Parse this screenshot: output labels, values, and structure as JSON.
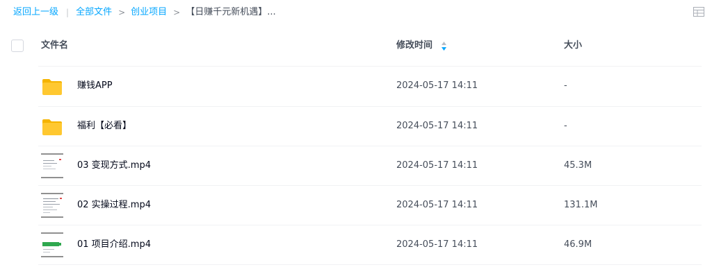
{
  "breadcrumb": {
    "back": "返回上一级",
    "separator": "|",
    "items": [
      {
        "label": "全部文件"
      },
      {
        "label": "创业项目"
      }
    ],
    "arrow": ">",
    "current": "【日赚千元新机遇】..."
  },
  "toolbar": {
    "view_icon": "grid-view-icon"
  },
  "table": {
    "headers": {
      "name": "文件名",
      "modified": "修改时间",
      "size": "大小"
    },
    "sort_icon": "sort-arrows-icon",
    "rows": [
      {
        "name": "赚钱APP",
        "modified": "2024-05-17 14:11",
        "size": "-",
        "kind": "folder"
      },
      {
        "name": "福利【必看】",
        "modified": "2024-05-17 14:11",
        "size": "-",
        "kind": "folder"
      },
      {
        "name": "03 变现方式.mp4",
        "modified": "2024-05-17 14:11",
        "size": "45.3M",
        "kind": "video"
      },
      {
        "name": "02 实操过程.mp4",
        "modified": "2024-05-17 14:11",
        "size": "131.1M",
        "kind": "video"
      },
      {
        "name": "01 项目介绍.mp4",
        "modified": "2024-05-17 14:11",
        "size": "46.9M",
        "kind": "video"
      }
    ]
  },
  "colors": {
    "link": "#06a7ff",
    "folder": "#ffc830",
    "sort_active": "#06a7ff"
  }
}
